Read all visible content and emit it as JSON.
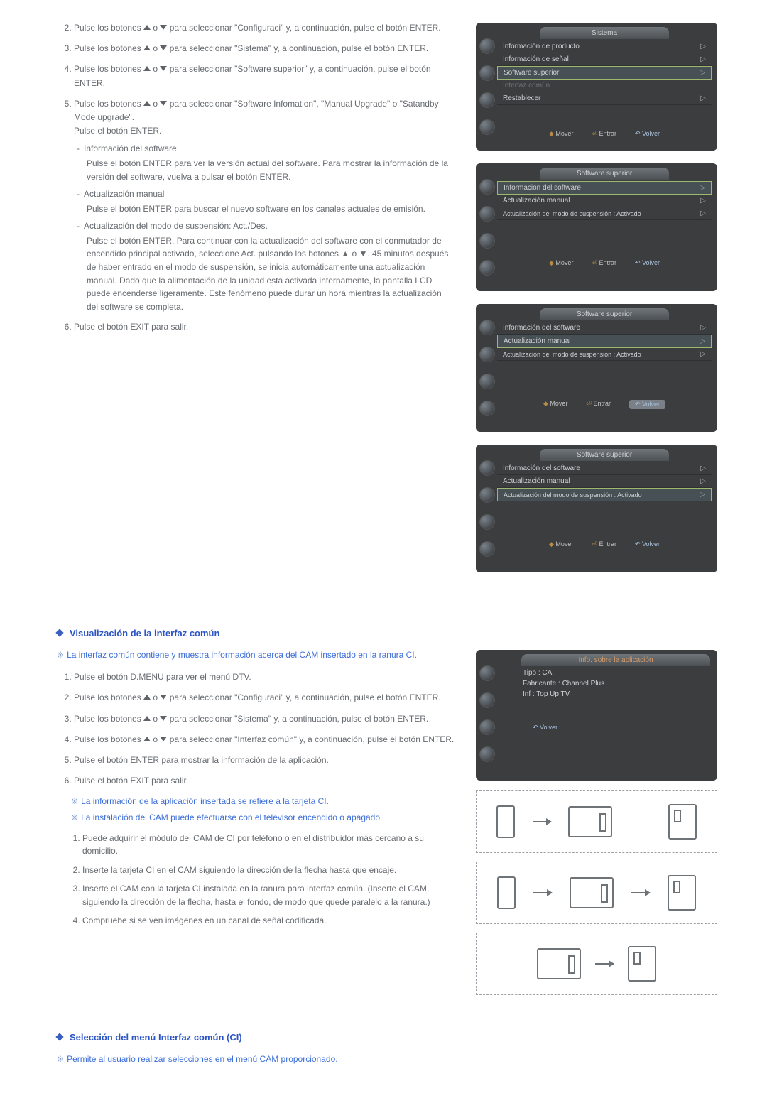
{
  "steps1": {
    "i2": "Pulse los botones ▲ o ▼ para seleccionar \"Configuraci\" y, a continuación, pulse el botón ENTER.",
    "i3": "Pulse los botones ▲ o ▼ para seleccionar \"Sistema\" y, a continuación, pulse el botón ENTER.",
    "i4": "Pulse los botones ▲ o ▼ para seleccionar \"Software superior\" y, a continuación, pulse el botón ENTER.",
    "i5a": "Pulse los botones ▲ o ▼ para seleccionar \"Software Infomation\", \"Manual Upgrade\" o \"Satandby Mode upgrade\".",
    "i5b": "Pulse el botón ENTER.",
    "b1t": "Información del software",
    "b1d": "Pulse el botón ENTER para ver la versión actual del software. Para mostrar la información de la versión del software, vuelva a pulsar el botón ENTER.",
    "b2t": "Actualización manual",
    "b2d": "Pulse el botón ENTER para buscar el nuevo software en los canales actuales de emisión.",
    "b3t": "Actualización del modo de suspensión: Act./Des.",
    "b3d": "Pulse el botón ENTER. Para continuar con la actualización del software con el conmutador de encendido principal activado, seleccione Act. pulsando los botones ▲ o ▼. 45 minutos después de haber entrado en el modo de suspensión, se inicia automáticamente una actualización manual. Dado que la alimentación de la unidad está activada internamente, la pantalla LCD puede encenderse ligeramente. Este fenómeno puede durar un hora mientras la actualización del software se completa.",
    "i6": "Pulse el botón EXIT para salir."
  },
  "osd1": {
    "tab": "Sistema",
    "r1": "Información de producto",
    "r2": "Información de señal",
    "r3": "Software superior",
    "r4": "Interfaz común",
    "r5": "Restablecer",
    "f1": "Mover",
    "f2": "Entrar",
    "f3": "Volver"
  },
  "osd2": {
    "tab": "Software superior",
    "r1": "Información del software",
    "r2": "Actualización manual",
    "r3": "Actualización del modo de suspensión : Activado"
  },
  "osd3": {
    "tab": "Software superior"
  },
  "osd4": {
    "tab": "Software superior"
  },
  "sec2": {
    "h": "Visualización de la interfaz común",
    "note": "La interfaz común contiene y muestra información acerca del CAM insertado en la ranura CI.",
    "s1": "Pulse el botón D.MENU para ver el menú DTV.",
    "s2": "Pulse los botones ▲ o ▼ para seleccionar \"Configuraci\" y, a continuación, pulse el botón ENTER.",
    "s3": "Pulse los botones ▲ o ▼ para seleccionar \"Sistema\" y, a continuación, pulse el botón ENTER.",
    "s4": "Pulse los botones ▲ o ▼ para seleccionar \"Interfaz común\" y, a continuación, pulse el botón ENTER.",
    "s5": "Pulse el botón ENTER para mostrar la información de la aplicación.",
    "s6": "Pulse el botón EXIT para salir.",
    "n1": "La información de la aplicación insertada se refiere a la tarjeta CI.",
    "n2": "La instalación del CAM puede efectuarse con el televisor encendido o apagado.",
    "c1": "Puede adquirir el módulo del CAM de CI por teléfono o en el distribuidor más cercano a su domicilio.",
    "c2": "Inserte la tarjeta CI en el CAM siguiendo la dirección de la flecha hasta que encaje.",
    "c3": "Inserte el CAM con la tarjeta CI instalada en la ranura para interfaz común. (Inserte el CAM, siguiendo la dirección de la flecha, hasta el fondo, de modo que quede paralelo a la ranura.)",
    "c4": "Compruebe si se ven imágenes en un canal de señal codificada."
  },
  "cam": {
    "tab": "Info. sobre la aplicación",
    "l1": "Tipo : CA",
    "l2": "Fabricante : Channel Plus",
    "l3": "Inf : Top Up TV",
    "foot": "Volver"
  },
  "sec3": {
    "h": "Selección del menú Interfaz común (CI)",
    "note": "Permite al usuario realizar selecciones en el menú CAM proporcionado."
  }
}
